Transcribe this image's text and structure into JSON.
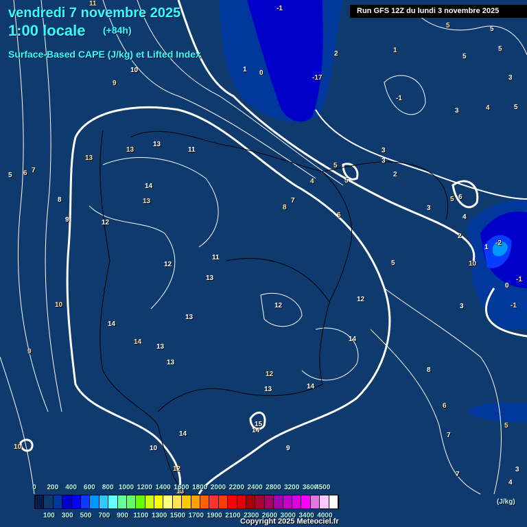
{
  "header": {
    "date": "vendredi 7 novembre 2025",
    "time": "1:00 locale",
    "lead": "(+84h)",
    "parameter": "Surface-Based CAPE (J/kg) et Lifted Index",
    "run": "Run GFS 12Z du lundi 3 novembre 2025"
  },
  "legend": {
    "unit": "(J/kg)",
    "top_ticks": [
      "0",
      "200",
      "400",
      "600",
      "800",
      "1000",
      "1200",
      "1400",
      "1600",
      "1800",
      "2000",
      "2200",
      "2400",
      "2800",
      "3200",
      "3600",
      "4500"
    ],
    "bottom_ticks": [
      "100",
      "300",
      "500",
      "700",
      "900",
      "1100",
      "1300",
      "1500",
      "1700",
      "1900",
      "2100",
      "2300",
      "2600",
      "3000",
      "3400",
      "4000"
    ],
    "colors": [
      "#0a1a4a",
      "#0f3a6e",
      "#00389c",
      "#0000c8",
      "#0000ff",
      "#0a3cff",
      "#0096ff",
      "#32c8ff",
      "#64ffff",
      "#64ff96",
      "#64ff64",
      "#64ff00",
      "#c8ff14",
      "#ffff00",
      "#ffff80",
      "#ffe650",
      "#ffc800",
      "#ffa000",
      "#ff6400",
      "#ff3232",
      "#ff3c00",
      "#ff0000",
      "#e10000",
      "#aa0000",
      "#aa0032",
      "#aa0064",
      "#aa00aa",
      "#c800c8",
      "#dc00dc",
      "#ff00ff",
      "#e178e1",
      "#ffc8ff",
      "#ffffff"
    ]
  },
  "lifted_index_labels": [
    "11",
    "-1",
    "2",
    "5",
    "5",
    "5",
    "1",
    "5",
    "10",
    "9",
    "1",
    "0",
    "-17",
    "-1",
    "3",
    "4",
    "3",
    "5",
    "13",
    "13",
    "11",
    "13",
    "3",
    "3",
    "5",
    "2",
    "5",
    "4",
    "14",
    "6",
    "13",
    "8",
    "7",
    "5",
    "4",
    "5",
    "6",
    "7",
    "3",
    "8",
    "12",
    "9",
    "6",
    "2",
    "1",
    "-2",
    "12",
    "11",
    "10",
    "5",
    "13",
    "-1",
    "0",
    "12",
    "10",
    "12",
    "3",
    "-1",
    "13",
    "14",
    "14",
    "13",
    "14",
    "9",
    "13",
    "8",
    "12",
    "13",
    "14",
    "6",
    "15",
    "14",
    "5",
    "14",
    "7",
    "10",
    "10",
    "9",
    "12",
    "7",
    "3",
    "13",
    "4"
  ],
  "copyright": "Copyright 2025 Meteociel.fr"
}
